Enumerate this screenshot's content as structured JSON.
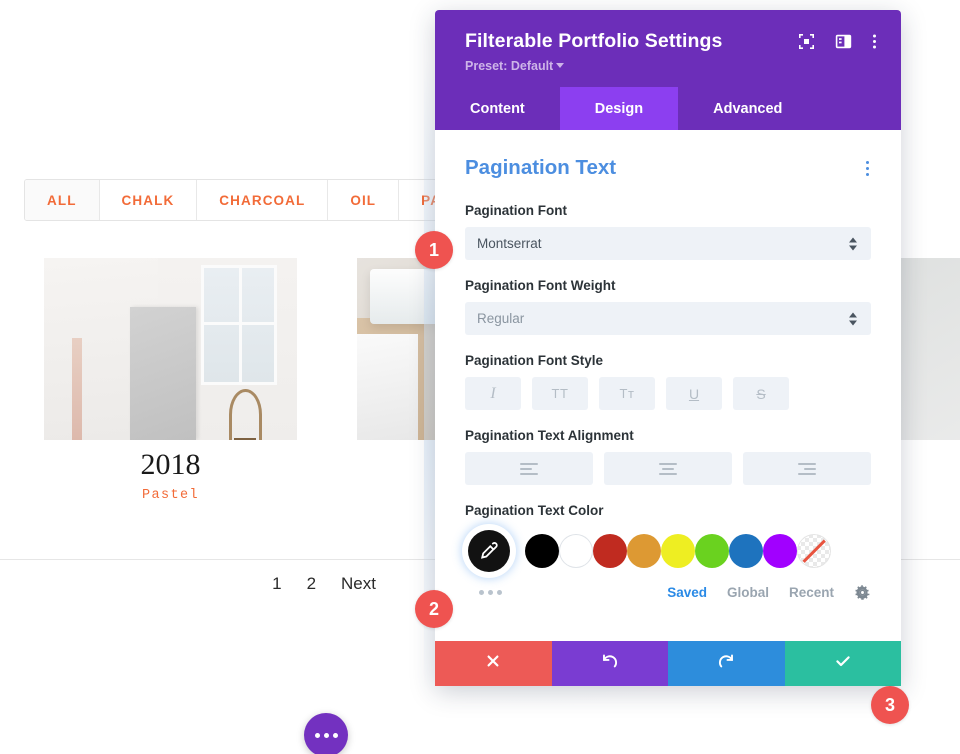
{
  "background": {
    "filters": [
      {
        "label": "ALL",
        "active": true
      },
      {
        "label": "CHALK",
        "active": false
      },
      {
        "label": "CHARCOAL",
        "active": false
      },
      {
        "label": "OIL",
        "active": false
      },
      {
        "label": "PASTEL",
        "active": false
      }
    ],
    "item": {
      "title": "2018",
      "category": "Pastel"
    },
    "pagination": [
      {
        "label": "1"
      },
      {
        "label": "2"
      },
      {
        "label": "Next"
      }
    ],
    "fab_icon": "ellipsis-icon"
  },
  "modal": {
    "title": "Filterable Portfolio Settings",
    "preset_label": "Preset: Default",
    "header_icons": [
      {
        "name": "focus-target-icon"
      },
      {
        "name": "layout-panel-icon"
      },
      {
        "name": "vertical-ellipsis-icon"
      }
    ],
    "tabs": [
      {
        "label": "Content",
        "active": false
      },
      {
        "label": "Design",
        "active": true
      },
      {
        "label": "Advanced",
        "active": false
      }
    ],
    "section": {
      "title": "Pagination Text",
      "options_icon": "vertical-ellipsis-icon"
    },
    "fields": {
      "font": {
        "label": "Pagination Font",
        "value": "Montserrat"
      },
      "font_weight": {
        "label": "Pagination Font Weight",
        "value": "Regular"
      },
      "font_style": {
        "label": "Pagination Font Style",
        "buttons": [
          {
            "name": "italic-button",
            "glyph": "I"
          },
          {
            "name": "uppercase-button",
            "glyph": "TT"
          },
          {
            "name": "small-caps-button",
            "glyph": "Tт"
          },
          {
            "name": "underline-button",
            "glyph": "U"
          },
          {
            "name": "strikethrough-button",
            "glyph": "S"
          }
        ]
      },
      "text_alignment": {
        "label": "Pagination Text Alignment",
        "buttons": [
          {
            "name": "align-left-button"
          },
          {
            "name": "align-center-button"
          },
          {
            "name": "align-right-button"
          }
        ]
      },
      "text_color": {
        "label": "Pagination Text Color",
        "eyedropper_icon": "eyedropper-icon",
        "more_icon": "more-dots-icon",
        "swatches": [
          {
            "name": "swatch-black",
            "color": "#000000"
          },
          {
            "name": "swatch-white",
            "color": "#ffffff"
          },
          {
            "name": "swatch-red",
            "color": "#c02b20"
          },
          {
            "name": "swatch-orange",
            "color": "#dd9933"
          },
          {
            "name": "swatch-yellow",
            "color": "#eeee22"
          },
          {
            "name": "swatch-green",
            "color": "#6ad21f"
          },
          {
            "name": "swatch-blue",
            "color": "#1e73be"
          },
          {
            "name": "swatch-purple",
            "color": "#a100ff"
          },
          {
            "name": "swatch-transparent",
            "color": "transparent"
          }
        ],
        "tabs": [
          {
            "label": "Saved",
            "active": true
          },
          {
            "label": "Global",
            "active": false
          },
          {
            "label": "Recent",
            "active": false
          }
        ],
        "settings_icon": "gear-icon"
      }
    },
    "footer": [
      {
        "name": "cancel-button",
        "icon": "close-x-icon",
        "color": "#ed5a56"
      },
      {
        "name": "undo-button",
        "icon": "undo-arrow-icon",
        "color": "#7a3cd2"
      },
      {
        "name": "redo-button",
        "icon": "redo-arrow-icon",
        "color": "#2d8ddc"
      },
      {
        "name": "save-button",
        "icon": "checkmark-icon",
        "color": "#2bbfa0"
      }
    ]
  },
  "badges": [
    {
      "label": "1"
    },
    {
      "label": "2"
    },
    {
      "label": "3"
    }
  ],
  "colors": {
    "brand_purple": "#6c2eb9",
    "tab_active_purple": "#8c3ff0",
    "accent_orange": "#f26b38",
    "section_blue": "#4c8ee0",
    "badge_red": "#ef5350"
  }
}
